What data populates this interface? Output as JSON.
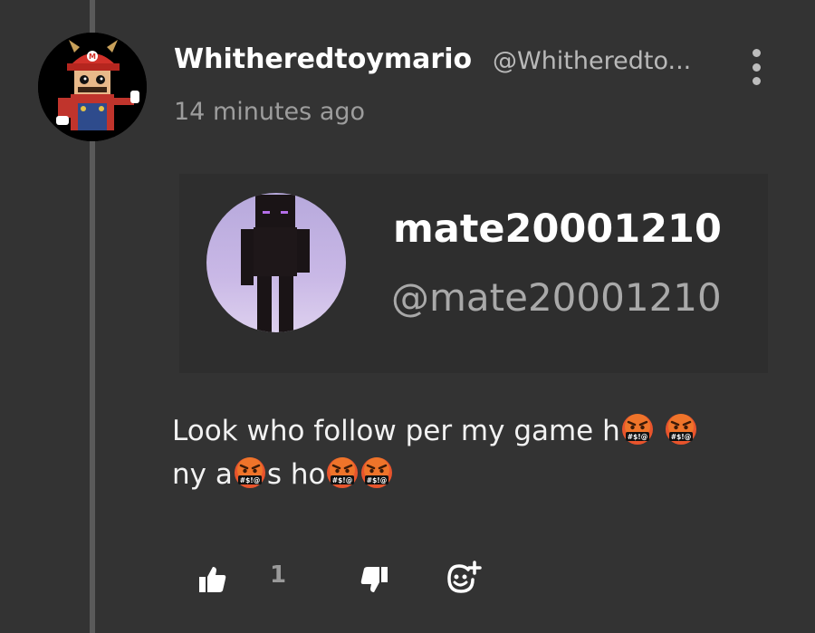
{
  "comment": {
    "author_name": "Whitheredtoymario",
    "author_handle": "@Whitheredto...",
    "timestamp": "14 minutes ago",
    "text_line1": "Look who follow per my game h",
    "text_line2_a": "ny a",
    "text_line2_b": "s ho",
    "emoji_name": "face-with-symbols-on-mouth",
    "emoji_symbols": "#$!@"
  },
  "embed": {
    "name": "mate20001210",
    "handle": "@mate20001210"
  },
  "actions": {
    "like_count": "1"
  },
  "colors": {
    "background": "#333333",
    "thread_line": "#5a5a5a",
    "text_primary": "#ffffff",
    "text_secondary": "#9d9d9d"
  }
}
